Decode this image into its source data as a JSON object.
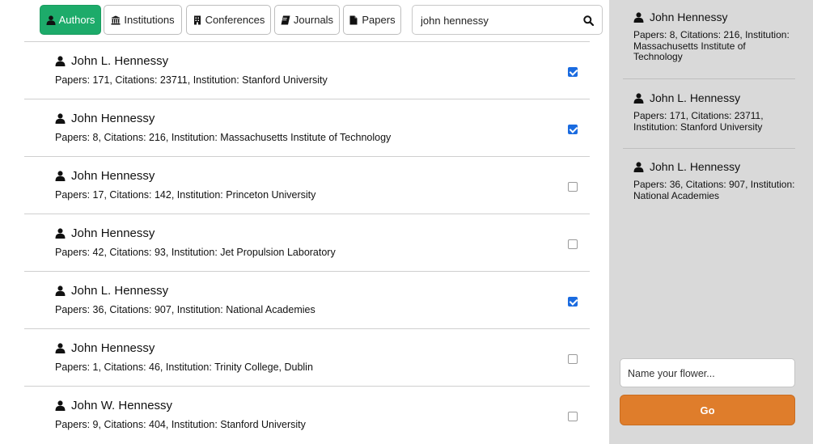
{
  "toolbar": {
    "tabs": [
      {
        "label": "Authors",
        "icon": "user-icon",
        "active": true
      },
      {
        "label": "Institutions",
        "icon": "institution-icon",
        "active": false
      },
      {
        "label": "Conferences",
        "icon": "conference-icon",
        "active": false
      },
      {
        "label": "Journals",
        "icon": "journal-icon",
        "active": false
      },
      {
        "label": "Papers",
        "icon": "paper-icon",
        "active": false
      }
    ],
    "search_value": "john hennessy",
    "search_icon": "search-icon"
  },
  "results": [
    {
      "name": "John L. Hennessy",
      "meta": "Papers: 171, Citations: 23711, Institution: Stanford University",
      "checked": true
    },
    {
      "name": "John Hennessy",
      "meta": "Papers: 8, Citations: 216, Institution: Massachusetts Institute of Technology",
      "checked": true
    },
    {
      "name": "John Hennessy",
      "meta": "Papers: 17, Citations: 142, Institution: Princeton University",
      "checked": false
    },
    {
      "name": "John Hennessy",
      "meta": "Papers: 42, Citations: 93, Institution: Jet Propulsion Laboratory",
      "checked": false
    },
    {
      "name": "John L. Hennessy",
      "meta": "Papers: 36, Citations: 907, Institution: National Academies",
      "checked": true
    },
    {
      "name": "John Hennessy",
      "meta": "Papers: 1, Citations: 46, Institution: Trinity College, Dublin",
      "checked": false
    },
    {
      "name": "John W. Hennessy",
      "meta": "Papers: 9, Citations: 404, Institution: Stanford University",
      "checked": false
    }
  ],
  "sidebar": {
    "selected": [
      {
        "name": "John Hennessy",
        "meta": "Papers: 8, Citations: 216, Institution: Massachusetts Institute of Technology"
      },
      {
        "name": "John L. Hennessy",
        "meta": "Papers: 171, Citations: 23711, Institution: Stanford University"
      },
      {
        "name": "John L. Hennessy",
        "meta": "Papers: 36, Citations: 907, Institution: National Academies"
      }
    ],
    "flower_placeholder": "Name your flower...",
    "go_label": "Go"
  },
  "colors": {
    "active_tab": "#1dab6a",
    "go_button": "#df7d2b",
    "checkbox_checked": "#1a6be0",
    "sidebar_bg": "#d9d9d9"
  }
}
